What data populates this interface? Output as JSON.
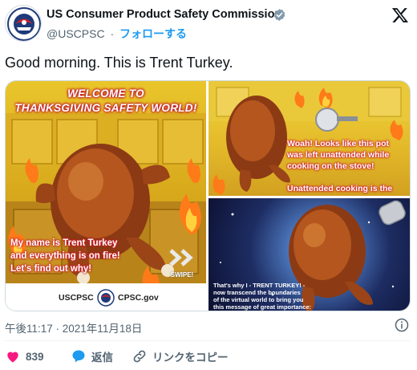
{
  "account": {
    "name": "US Consumer Product Safety Commission",
    "handle": "@USCPSC",
    "separator": "·",
    "follow_label": "フォローする",
    "avatar_icon": "cpsc-seal-icon"
  },
  "tweet": {
    "text": "Good morning. This is Trent Turkey."
  },
  "media": {
    "panel1": {
      "banner_line1": "WELCOME TO",
      "banner_line2": "THANKSGIVING SAFETY WORLD!",
      "caption_line1": "My name is Trent Turkey",
      "caption_line2": "and everything is on fire!",
      "caption_line3": "Let's find out why!",
      "swipe_label": "SWIPE!",
      "footer_left": "USCPSC",
      "footer_right": "CPSC.gov"
    },
    "panel2": {
      "line1": "Woah! Looks like this pot",
      "line2": "was left unattended while",
      "line3": "cooking on the stove!",
      "line4": "Unattended cooking is the"
    },
    "panel3": {
      "line1": "That's why I - TRENT TURKEY! -",
      "line2": "now transcend the boundaries",
      "line3": "of the virtual world to bring you",
      "line4": "this message of great importance:"
    }
  },
  "meta": {
    "timestamp": "午後11:17 · 2021年11月18日"
  },
  "actions": {
    "like_count": "839",
    "reply_label": "返信",
    "copy_link_label": "リンクをコピー"
  },
  "colors": {
    "accent": "#1d9bf0",
    "like": "#f91880",
    "verified": "#829aab",
    "text": "#0f1419",
    "muted": "#536471"
  }
}
